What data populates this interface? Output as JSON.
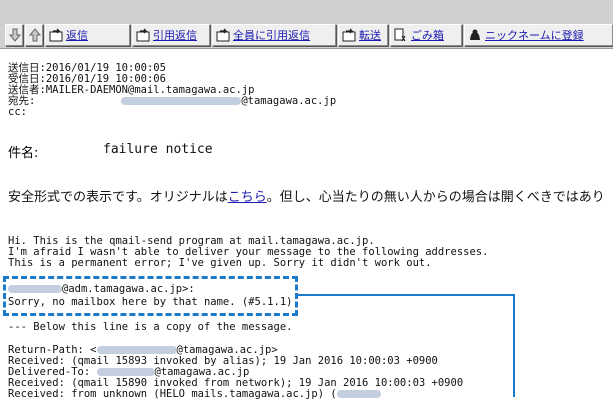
{
  "toolbar": {
    "buttons": [
      {
        "label": "",
        "icon": "arrow-down-icon"
      },
      {
        "label": "",
        "icon": "arrow-up-icon"
      },
      {
        "label": "返信",
        "icon": "reply-icon"
      },
      {
        "label": "引用返信",
        "icon": "quote-reply-icon"
      },
      {
        "label": "全員に引用返信",
        "icon": "reply-all-icon"
      },
      {
        "label": "転送",
        "icon": "forward-icon"
      },
      {
        "label": "ごみ箱",
        "icon": "trash-icon"
      },
      {
        "label": "ニックネームに登録",
        "icon": "nickname-icon"
      }
    ]
  },
  "header": {
    "sent": "送信日:2016/01/19 10:00:05",
    "received": "受信日:2016/01/19 10:00:06",
    "sender": "送信者:MAILER-DAEMON@mail.tamagawa.ac.jp",
    "to_label": "宛先:",
    "to_domain": "@tamagawa.ac.jp",
    "cc_label": "cc:"
  },
  "subject": {
    "label": "件名:",
    "value": "failure notice"
  },
  "safe_notice": {
    "before": "安全形式での表示です。オリジナルは",
    "link": "こちら",
    "after": "。但し、心当たりの無い人からの場合は開くべきではあり"
  },
  "body": {
    "line1": "Hi. This is the qmail-send program at mail.tamagawa.ac.jp.",
    "line2": "I'm afraid I wasn't able to deliver your message to the following addresses.",
    "line3": "This is a permanent error; I've given up. Sorry it didn't work out.",
    "bounce_addr_suffix": "@adm.tamagawa.ac.jp>:",
    "bounce_reason": "Sorry, no mailbox here by that name. (#5.1.1)",
    "copy_separator": "--- Below this line is a copy of the message.",
    "return_path_prefix": "Return-Path: <",
    "return_path_suffix": "@tamagawa.ac.jp>",
    "received1": "Received: (qmail 15893 invoked by alias); 19 Jan 2016 10:00:03 +0900",
    "delivered_to_prefix": "Delivered-To: ",
    "delivered_to_suffix": "@tamagawa.ac.jp",
    "received2": "Received: (qmail 15890 invoked from network); 19 Jan 2016 10:00:03 +0900",
    "received3": "Received: from unknown (HELO mails.tamagawa.ac.jp) ("
  },
  "colors": {
    "toolbar_bg": "#d0d0d0",
    "link": "#1a1ab0",
    "callout": "#1a7acc"
  }
}
